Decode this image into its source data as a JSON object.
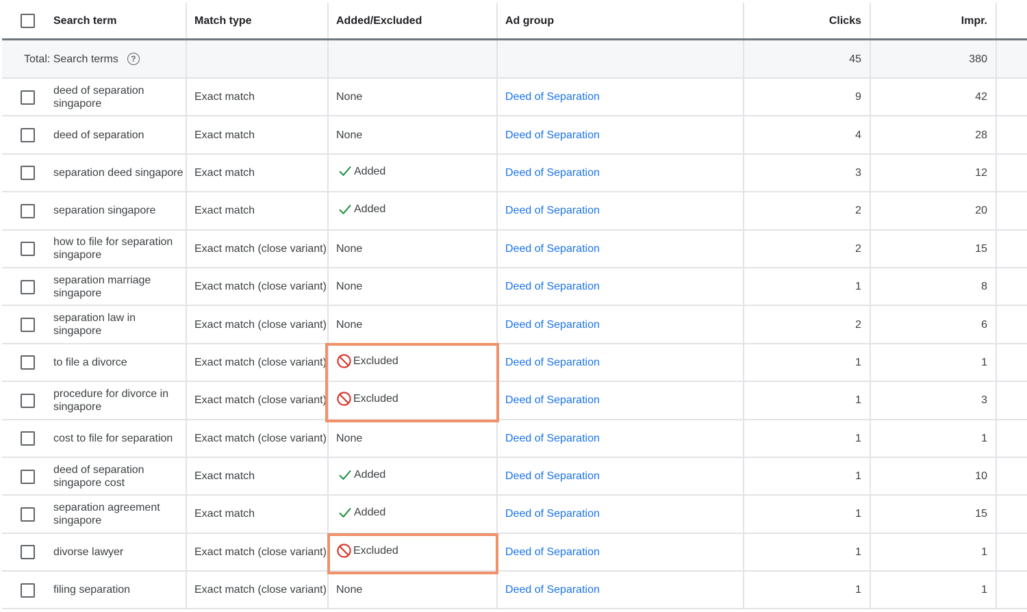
{
  "table": {
    "columns": {
      "search_term": "Search term",
      "match_type": "Match type",
      "added_excluded": "Added/Excluded",
      "ad_group": "Ad group",
      "clicks": "Clicks",
      "impr": "Impr."
    },
    "total": {
      "label": "Total: Search terms",
      "clicks": "45",
      "impr": "380"
    },
    "rows": [
      {
        "term": "deed of separation singapore",
        "match": "Exact match",
        "status": "None",
        "status_type": "none",
        "ad_group": "Deed of Separation",
        "clicks": "9",
        "impr": "42"
      },
      {
        "term": "deed of separation",
        "match": "Exact match",
        "status": "None",
        "status_type": "none",
        "ad_group": "Deed of Separation",
        "clicks": "4",
        "impr": "28"
      },
      {
        "term": "separation deed singapore",
        "match": "Exact match",
        "status": "Added",
        "status_type": "added",
        "ad_group": "Deed of Separation",
        "clicks": "3",
        "impr": "12"
      },
      {
        "term": "separation singapore",
        "match": "Exact match",
        "status": "Added",
        "status_type": "added",
        "ad_group": "Deed of Separation",
        "clicks": "2",
        "impr": "20"
      },
      {
        "term": "how to file for separation singapore",
        "match": "Exact match (close variant)",
        "status": "None",
        "status_type": "none",
        "ad_group": "Deed of Separation",
        "clicks": "2",
        "impr": "15"
      },
      {
        "term": "separation marriage singapore",
        "match": "Exact match (close variant)",
        "status": "None",
        "status_type": "none",
        "ad_group": "Deed of Separation",
        "clicks": "1",
        "impr": "8"
      },
      {
        "term": "separation law in singapore",
        "match": "Exact match (close variant)",
        "status": "None",
        "status_type": "none",
        "ad_group": "Deed of Separation",
        "clicks": "2",
        "impr": "6"
      },
      {
        "term": "to file a divorce",
        "match": "Exact match (close variant)",
        "status": "Excluded",
        "status_type": "excluded",
        "ad_group": "Deed of Separation",
        "clicks": "1",
        "impr": "1"
      },
      {
        "term": "procedure for divorce in singapore",
        "match": "Exact match (close variant)",
        "status": "Excluded",
        "status_type": "excluded",
        "ad_group": "Deed of Separation",
        "clicks": "1",
        "impr": "3"
      },
      {
        "term": "cost to file for separation",
        "match": "Exact match (close variant)",
        "status": "None",
        "status_type": "none",
        "ad_group": "Deed of Separation",
        "clicks": "1",
        "impr": "1"
      },
      {
        "term": "deed of separation singapore cost",
        "match": "Exact match",
        "status": "Added",
        "status_type": "added",
        "ad_group": "Deed of Separation",
        "clicks": "1",
        "impr": "10"
      },
      {
        "term": "separation agreement singapore",
        "match": "Exact match",
        "status": "Added",
        "status_type": "added",
        "ad_group": "Deed of Separation",
        "clicks": "1",
        "impr": "15"
      },
      {
        "term": "divorse lawyer",
        "match": "Exact match (close variant)",
        "status": "Excluded",
        "status_type": "excluded",
        "ad_group": "Deed of Separation",
        "clicks": "1",
        "impr": "1"
      },
      {
        "term": "filing separation",
        "match": "Exact match (close variant)",
        "status": "None",
        "status_type": "none",
        "ad_group": "Deed of Separation",
        "clicks": "1",
        "impr": "1"
      }
    ]
  },
  "colors": {
    "link": "#1a73e8",
    "added_check": "#1e8e3e",
    "excluded_icon": "#d93025",
    "highlight_box": "#f0916a"
  },
  "icons": {
    "added": "checkmark-icon",
    "excluded": "block-icon",
    "help": "help-circle-icon"
  }
}
